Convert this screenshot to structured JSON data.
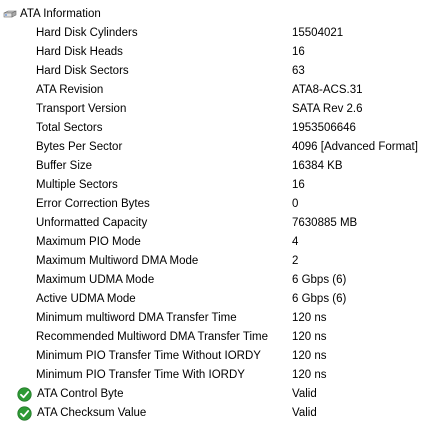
{
  "section": {
    "title": "ATA Information",
    "icon": "drive-info-icon"
  },
  "properties": [
    {
      "label": "Hard Disk Cylinders",
      "value": "15504021"
    },
    {
      "label": "Hard Disk Heads",
      "value": "16"
    },
    {
      "label": "Hard Disk Sectors",
      "value": "63"
    },
    {
      "label": "ATA Revision",
      "value": "ATA8-ACS.31"
    },
    {
      "label": "Transport Version",
      "value": "SATA Rev 2.6"
    },
    {
      "label": "Total Sectors",
      "value": "1953506646"
    },
    {
      "label": "Bytes Per Sector",
      "value": "4096 [Advanced Format]"
    },
    {
      "label": "Buffer Size",
      "value": "16384 KB"
    },
    {
      "label": "Multiple Sectors",
      "value": "16"
    },
    {
      "label": "Error Correction Bytes",
      "value": "0"
    },
    {
      "label": "Unformatted Capacity",
      "value": "7630885 MB"
    },
    {
      "label": "Maximum PIO Mode",
      "value": "4"
    },
    {
      "label": "Maximum Multiword DMA Mode",
      "value": "2"
    },
    {
      "label": "Maximum UDMA Mode",
      "value": "6 Gbps (6)"
    },
    {
      "label": "Active UDMA Mode",
      "value": "6 Gbps (6)"
    },
    {
      "label": "Minimum multiword DMA Transfer Time",
      "value": "120 ns"
    },
    {
      "label": "Recommended Multiword DMA Transfer Time",
      "value": "120 ns"
    },
    {
      "label": "Minimum PIO Transfer Time Without IORDY",
      "value": "120 ns"
    },
    {
      "label": "Minimum PIO Transfer Time With IORDY",
      "value": "120 ns"
    }
  ],
  "status_rows": [
    {
      "label": "ATA Control Byte",
      "value": "Valid",
      "icon": "check-icon"
    },
    {
      "label": "ATA Checksum Value",
      "value": "Valid",
      "icon": "check-icon"
    }
  ],
  "colors": {
    "check_green": "#2e9a35",
    "text": "#000000",
    "background": "#ffffff"
  }
}
